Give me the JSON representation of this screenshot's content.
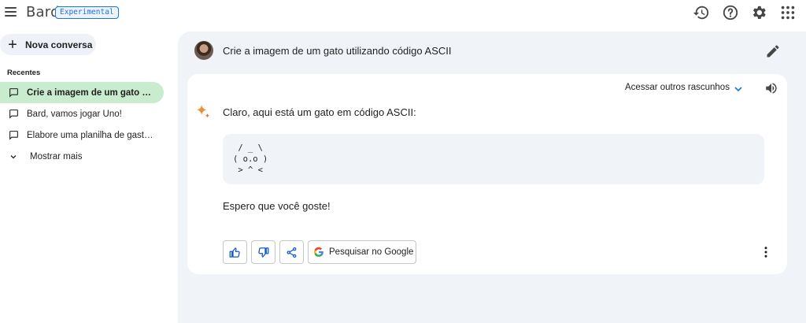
{
  "app": {
    "logo": "Bard",
    "badge": "Experimental"
  },
  "topbar": {
    "icons": [
      "history-icon",
      "help-icon",
      "settings-icon",
      "apps-grid-icon"
    ]
  },
  "sidebar": {
    "new_chat_label": "Nova conversa",
    "recent_title": "Recentes",
    "items": [
      {
        "label": "Crie a imagem de um gato utilizando código ASCII",
        "active": true
      },
      {
        "label": "Bard, vamos jogar Uno!",
        "active": false
      },
      {
        "label": "Elabore uma planilha de gastos mensais",
        "active": false
      }
    ],
    "show_more_label": "Mostrar mais"
  },
  "conversation": {
    "query": "Crie a imagem de um gato utilizando código ASCII",
    "drafts_label": "Acessar outros rascunhos",
    "reply_intro": "Claro, aqui está um gato em código ASCII:",
    "ascii_lines": [
      " / _ \\",
      "( o.o )",
      " > ^ <"
    ],
    "reply_outro": "Espero que você goste!",
    "google_button_label": "Pesquisar no Google"
  },
  "colors": {
    "accent": "#1a73e8",
    "active_item": "#c9eccf",
    "main_bg": "#f0f4f9"
  }
}
